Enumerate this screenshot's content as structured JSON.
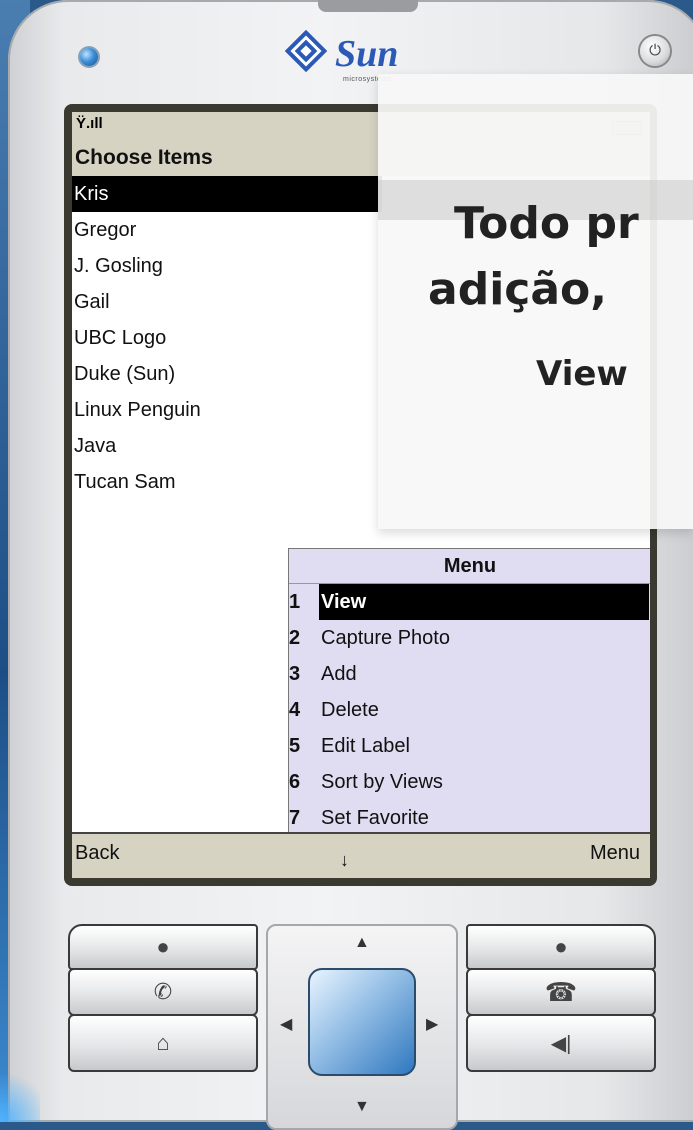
{
  "phone": {
    "brand_name": "Sun",
    "brand_sub": "microsystems",
    "power_icon": "power-icon"
  },
  "screen": {
    "title": "Choose Items",
    "items": [
      "Kris",
      "Gregor",
      "J. Gosling",
      "Gail",
      "UBC Logo",
      "Duke (Sun)",
      "Linux Penguin",
      "Java",
      "Tucan Sam"
    ],
    "selected_index": 0,
    "softkeys": {
      "left": "Back",
      "right": "Menu"
    }
  },
  "menu": {
    "title": "Menu",
    "items": [
      {
        "num": "1",
        "label": "View"
      },
      {
        "num": "2",
        "label": "Capture Photo"
      },
      {
        "num": "3",
        "label": "Add"
      },
      {
        "num": "4",
        "label": "Delete"
      },
      {
        "num": "5",
        "label": "Edit Label"
      },
      {
        "num": "6",
        "label": "Sort by Views"
      },
      {
        "num": "7",
        "label": "Set Favorite"
      }
    ],
    "selected_index": 0
  },
  "overlay": {
    "line1": "Todo pr",
    "line2": "adição,",
    "line3": "View"
  },
  "colors": {
    "screen_chrome": "#d7d3c3",
    "menu_bg": "#e0dcf2",
    "led": "#3b8fd8",
    "brand": "#2b59b8"
  }
}
